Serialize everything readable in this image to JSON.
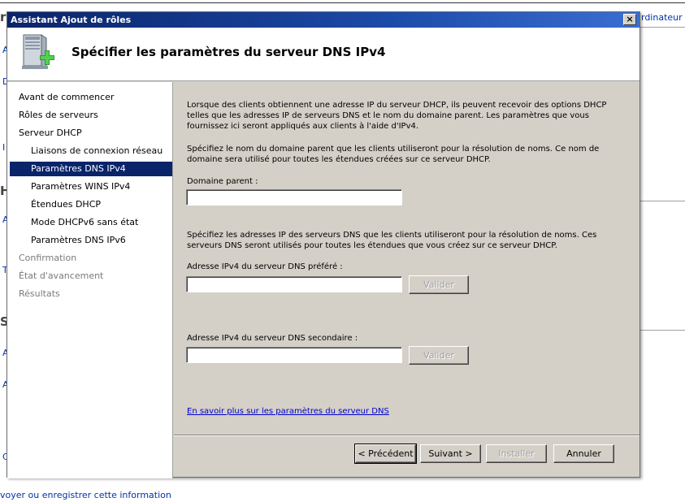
{
  "background": {
    "letters": [
      "r",
      "A",
      "D",
      "I",
      "H",
      "A",
      "T",
      "S",
      "A",
      "A",
      "C"
    ],
    "top_right_link": "rdinateur",
    "bottom_link": "voyer ou enregistrer cette information"
  },
  "dialog": {
    "title": "Assistant Ajout de rôles",
    "close_label": "×",
    "header_title": "Spécifier les paramètres du serveur DNS IPv4",
    "icon": "server-add-icon"
  },
  "sidebar": {
    "steps": [
      {
        "label": "Avant de commencer"
      },
      {
        "label": "Rôles de serveurs"
      },
      {
        "label": "Serveur DHCP"
      },
      {
        "label": "Liaisons de connexion réseau"
      },
      {
        "label": "Paramètres DNS IPv4"
      },
      {
        "label": "Paramètres WINS IPv4"
      },
      {
        "label": "Étendues DHCP"
      },
      {
        "label": "Mode DHCPv6 sans état"
      },
      {
        "label": "Paramètres DNS IPv6"
      },
      {
        "label": "Confirmation"
      },
      {
        "label": "État d'avancement"
      },
      {
        "label": "Résultats"
      }
    ]
  },
  "content": {
    "intro": "Lorsque des clients obtiennent une adresse IP du serveur DHCP, ils peuvent recevoir des options DHCP telles que les adresses IP de serveurs DNS et le nom du domaine parent. Les paramètres que vous fournissez ici seront appliqués aux clients à l'aide d'IPv4.",
    "domain_instruction": "Spécifiez le nom du domaine parent que les clients utiliseront pour la résolution de noms. Ce nom de domaine sera utilisé pour toutes les étendues créées sur ce serveur DHCP.",
    "domain_label": "Domaine parent :",
    "domain_value": "",
    "dns_instruction": "Spécifiez les adresses IP des serveurs DNS que les clients utiliseront pour la résolution de noms. Ces serveurs DNS seront utilisés pour toutes les étendues que vous créez sur ce serveur DHCP.",
    "preferred_label": "Adresse IPv4 du serveur DNS préféré :",
    "preferred_value": "",
    "secondary_label": "Adresse IPv4 du serveur DNS secondaire :",
    "secondary_value": "",
    "validate_label": "Valider",
    "help_link": "En savoir plus sur les paramètres du serveur DNS"
  },
  "footer": {
    "previous": "< Précédent",
    "next": "Suivant >",
    "install": "Installer",
    "cancel": "Annuler"
  }
}
